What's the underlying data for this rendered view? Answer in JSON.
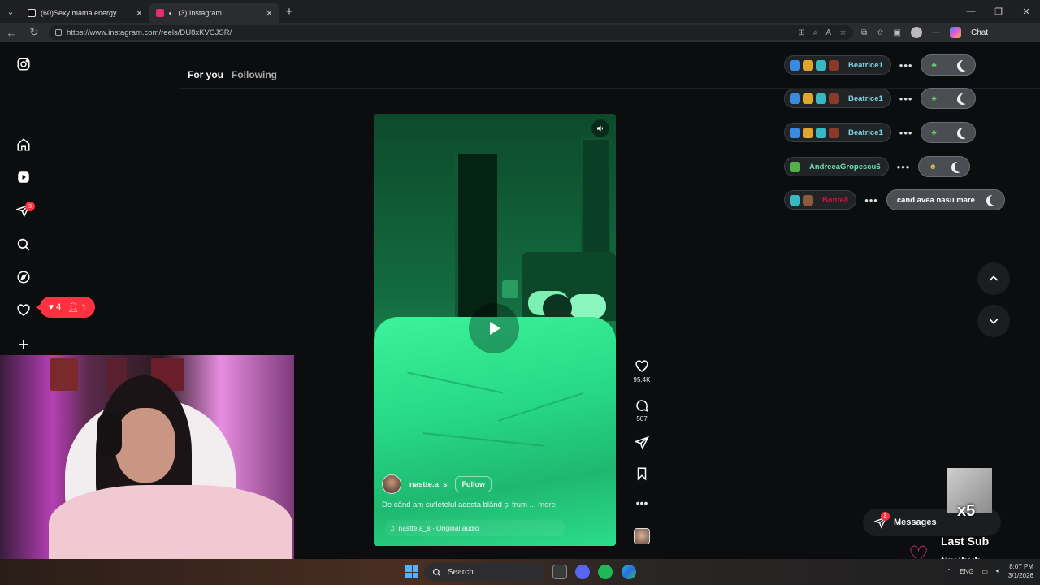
{
  "browser": {
    "tabs": [
      {
        "title": "(60)Sexy mama energy.💗 #andre",
        "favicon_color": "#111111",
        "active": false
      },
      {
        "title": "(3) Instagram",
        "favicon_color": "#e1306c",
        "active": true
      }
    ],
    "url": "https://www.instagram.com/reels/DU8xKVCJSR/",
    "chat_label": "Chat"
  },
  "instagram": {
    "feed_tabs": {
      "for_you": "For you",
      "following": "Following"
    },
    "nav_badge": "3",
    "notifications": {
      "likes": "4",
      "follows": "1"
    },
    "reel": {
      "author": "nastte.a_s",
      "follow_label": "Follow",
      "caption": "De când am sufletelul acesta blând și frum ...",
      "more_label": "more",
      "audio": "nastte.a_s · Original audio"
    },
    "actions": {
      "likes": "95.4K",
      "comments": "507"
    },
    "messages": {
      "label": "Messages",
      "badge": "3"
    }
  },
  "stream_chat": [
    {
      "user": "Beatrice1",
      "color": "name-blue",
      "message": ""
    },
    {
      "user": "Beatrice1",
      "color": "name-blue",
      "message": ""
    },
    {
      "user": "Beatrice1",
      "color": "name-blue",
      "message": ""
    },
    {
      "user": "AndreeaGropescu6",
      "color": "name-green",
      "message": ""
    },
    {
      "user": "Bonte8",
      "color": "name-red",
      "message": "cand avea nasu mare"
    }
  ],
  "overlay": {
    "last_sub_label": "Last Sub",
    "last_sub_name": "timihxh",
    "gift_multiplier": "x5"
  },
  "taskbar": {
    "search_label": "Search",
    "language": "ENG",
    "time": "8:07 PM",
    "date": "3/1/2026"
  }
}
